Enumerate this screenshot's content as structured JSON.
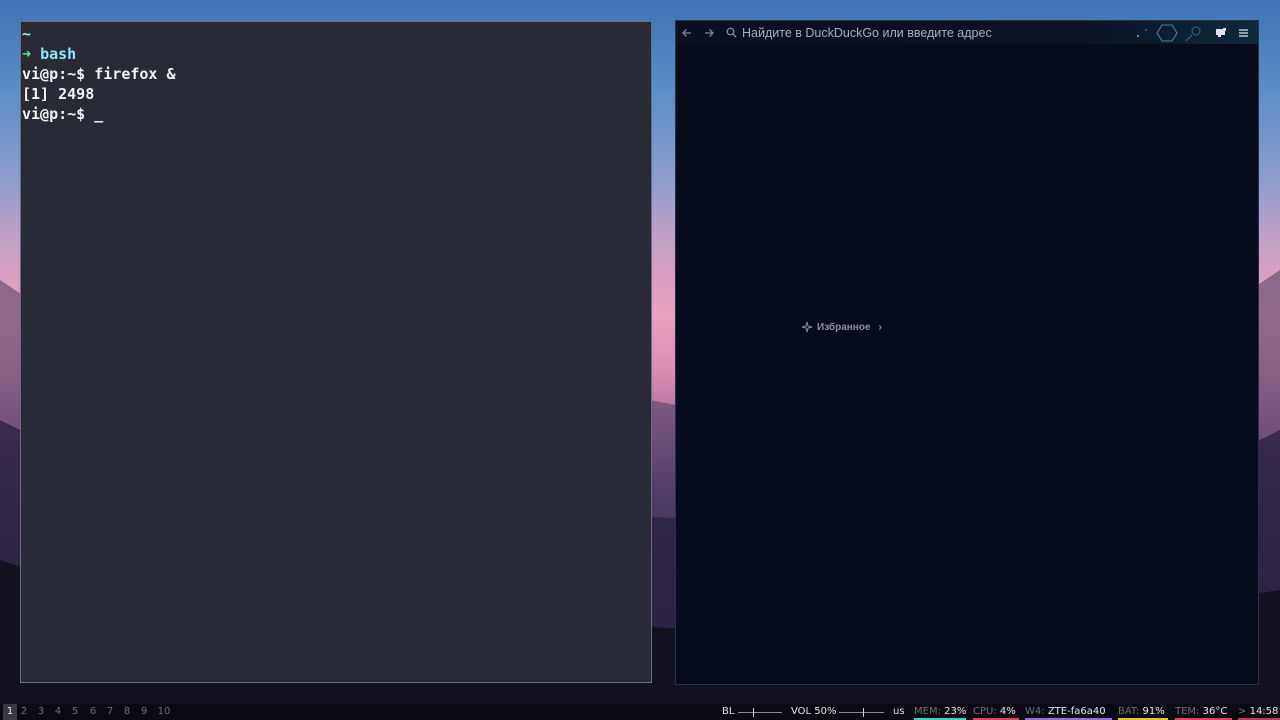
{
  "terminal": {
    "lines": {
      "cwd": "~",
      "prompt_arrow": "➜",
      "shell": "bash",
      "cmd1_prompt": "vi@p:~$",
      "cmd1_text": "firefox &",
      "job": "[1] 2498",
      "cmd2_prompt": "vi@p:~$",
      "cursor": "_"
    }
  },
  "browser": {
    "url_placeholder": "Найдите в DuckDuckGo или введите адрес",
    "favorites_label": "Избранное",
    "icons": {
      "back": "arrow-left-icon",
      "forward": "arrow-right-icon",
      "search": "search-icon",
      "extension": "extension-icon",
      "menu": "hamburger-menu-icon",
      "favorites": "sparkle-icon",
      "favorites_chevron": "chevron-right-icon"
    }
  },
  "statusbar": {
    "workspaces": [
      "1",
      "2",
      "3",
      "4",
      "5",
      "6",
      "7",
      "8",
      "9",
      "10"
    ],
    "active_workspace": "1",
    "backlight_label": "BL",
    "volume_label": "VOL 50%",
    "keyboard_layout": "us",
    "mem_label": "MEM:",
    "mem_value": "23%",
    "cpu_label": "CPU:",
    "cpu_value": "4%",
    "wifi_label": "W4:",
    "wifi_value": "ZTE-fa6a40",
    "bat_label": "BAT:",
    "bat_value": "91%",
    "temp_label": "TEM:",
    "temp_value": "36°C",
    "clock_sep": ">",
    "clock": "14:58",
    "colors": {
      "mem": "#3fd1c0",
      "cpu": "#e0405a",
      "wifi": "#9a6cd8",
      "bat": "#e6c13c",
      "temp": "#e0405a",
      "clock": "#c03a52"
    }
  }
}
